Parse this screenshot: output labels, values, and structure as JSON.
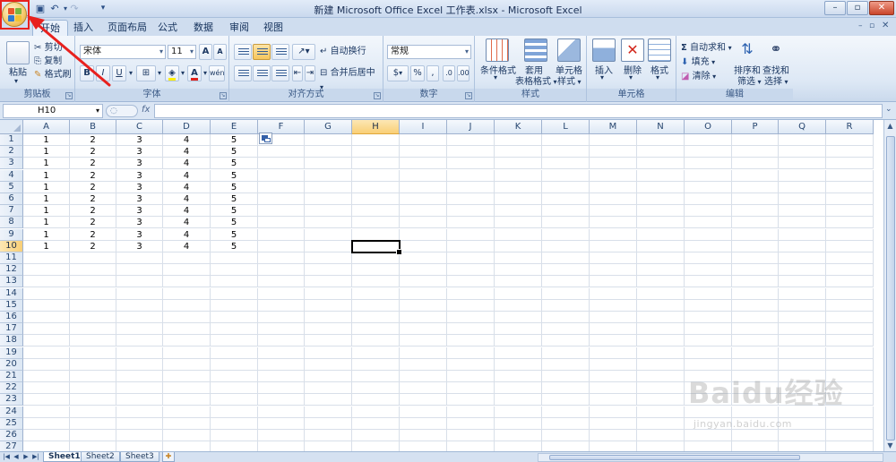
{
  "window": {
    "title": "新建 Microsoft Office Excel 工作表.xlsx - Microsoft Excel",
    "controls": {
      "minimize": "–",
      "maximize": "▫",
      "close": "✕"
    }
  },
  "quick_access": {
    "items": [
      "save-icon",
      "undo-icon",
      "redo-icon",
      "customize-icon"
    ],
    "customize": "▾"
  },
  "tabs": [
    {
      "label": "开始",
      "active": true
    },
    {
      "label": "插入"
    },
    {
      "label": "页面布局"
    },
    {
      "label": "公式"
    },
    {
      "label": "数据"
    },
    {
      "label": "审阅"
    },
    {
      "label": "视图"
    }
  ],
  "help": "?",
  "ribbon": {
    "clipboard": {
      "label": "剪贴板",
      "paste": "粘贴",
      "cut": "剪切",
      "copy": "复制",
      "format_painter": "格式刷"
    },
    "font": {
      "label": "字体",
      "font_name": "宋体",
      "font_size": "11",
      "grow": "A",
      "shrink": "A",
      "bold": "B",
      "italic": "I",
      "underline": "U",
      "font_color_letter": "A",
      "wen": "wén"
    },
    "alignment": {
      "label": "对齐方式",
      "wrap": "自动换行",
      "merge": "合并后居中"
    },
    "number": {
      "label": "数字",
      "format": "常规",
      "currency": "$",
      "percent": "%",
      "comma": ","
    },
    "styles": {
      "label": "样式",
      "conditional": "条件格式",
      "table_line1": "套用",
      "table_line2": "表格格式",
      "cell_line1": "单元格",
      "cell_line2": "样式"
    },
    "cells": {
      "label": "单元格",
      "insert": "插入",
      "delete": "删除",
      "format": "格式"
    },
    "editing": {
      "label": "编辑",
      "autosum": "自动求和",
      "fill": "填充",
      "clear": "清除",
      "sort_line1": "排序和",
      "sort_line2": "筛选",
      "find_line1": "查找和",
      "find_line2": "选择"
    }
  },
  "formula_bar": {
    "name_box": "H10",
    "fx": "fx",
    "value": ""
  },
  "grid": {
    "columns": [
      "A",
      "B",
      "C",
      "D",
      "E",
      "F",
      "G",
      "H",
      "I",
      "J",
      "K",
      "L",
      "M",
      "N",
      "O",
      "P",
      "Q",
      "R"
    ],
    "rows": [
      "1",
      "2",
      "3",
      "4",
      "5",
      "6",
      "7",
      "8",
      "9",
      "10",
      "11",
      "12",
      "13",
      "14",
      "15",
      "16",
      "17",
      "18",
      "19",
      "20",
      "21",
      "22",
      "23",
      "24",
      "25",
      "26",
      "27"
    ],
    "selected_column": "H",
    "selected_row": "10",
    "active_cell": "H10",
    "data": [
      [
        "1",
        "2",
        "3",
        "4",
        "5"
      ],
      [
        "1",
        "2",
        "3",
        "4",
        "5"
      ],
      [
        "1",
        "2",
        "3",
        "4",
        "5"
      ],
      [
        "1",
        "2",
        "3",
        "4",
        "5"
      ],
      [
        "1",
        "2",
        "3",
        "4",
        "5"
      ],
      [
        "1",
        "2",
        "3",
        "4",
        "5"
      ],
      [
        "1",
        "2",
        "3",
        "4",
        "5"
      ],
      [
        "1",
        "2",
        "3",
        "4",
        "5"
      ],
      [
        "1",
        "2",
        "3",
        "4",
        "5"
      ],
      [
        "1",
        "2",
        "3",
        "4",
        "5"
      ]
    ]
  },
  "sheet_tabs": [
    {
      "label": "Sheet1",
      "active": true
    },
    {
      "label": "Sheet2"
    },
    {
      "label": "Sheet3"
    }
  ],
  "watermark": {
    "brand": "Baidu经验",
    "url": "jingyan.baidu.com"
  },
  "colors": {
    "highlight": "#e8211e",
    "accent": "#f9cf76",
    "ribbon": "#dde8f5"
  }
}
